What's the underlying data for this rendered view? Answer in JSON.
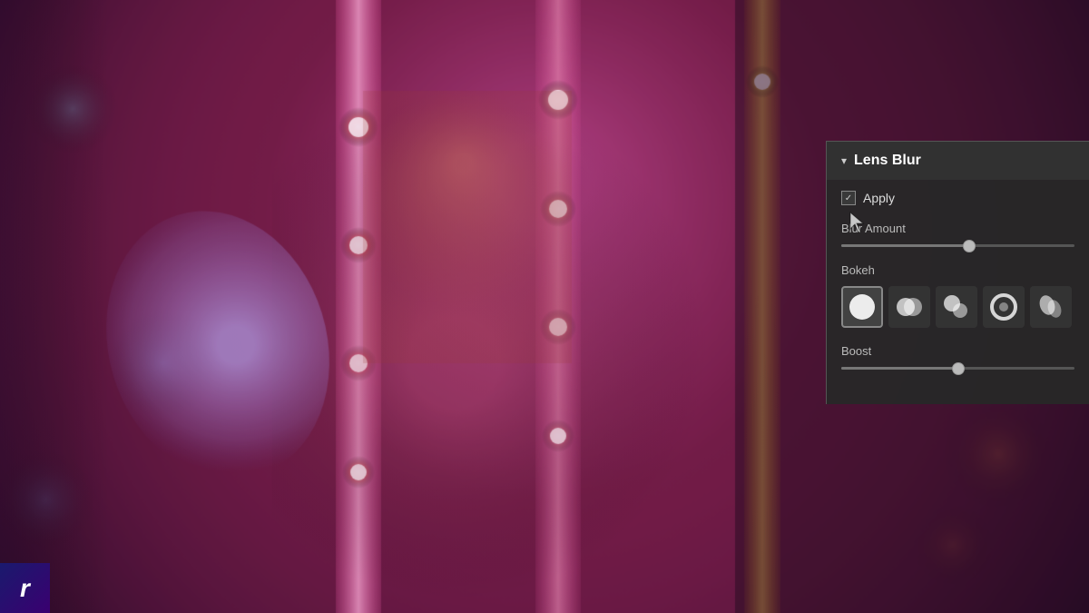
{
  "panel": {
    "title": "Lens Blur",
    "chevron": "▾",
    "apply_label": "Apply",
    "apply_checked": true,
    "blur_amount_label": "Blur Amount",
    "blur_amount_value": 55,
    "bokeh_label": "Bokeh",
    "bokeh_options": [
      {
        "id": "circle",
        "selected": true
      },
      {
        "id": "double-circle",
        "selected": false
      },
      {
        "id": "rounded",
        "selected": false
      },
      {
        "id": "cat-eye",
        "selected": false
      },
      {
        "id": "swirl",
        "selected": false
      }
    ],
    "boost_label": "Boost",
    "boost_value": 50
  },
  "logo": {
    "letter": "r"
  },
  "colors": {
    "panel_bg": "#282828",
    "panel_border": "#555555",
    "text_primary": "#ffffff",
    "text_secondary": "#bbbbbb",
    "slider_track": "#555555",
    "slider_thumb": "#bbbbbb",
    "selected_border": "#888888"
  }
}
